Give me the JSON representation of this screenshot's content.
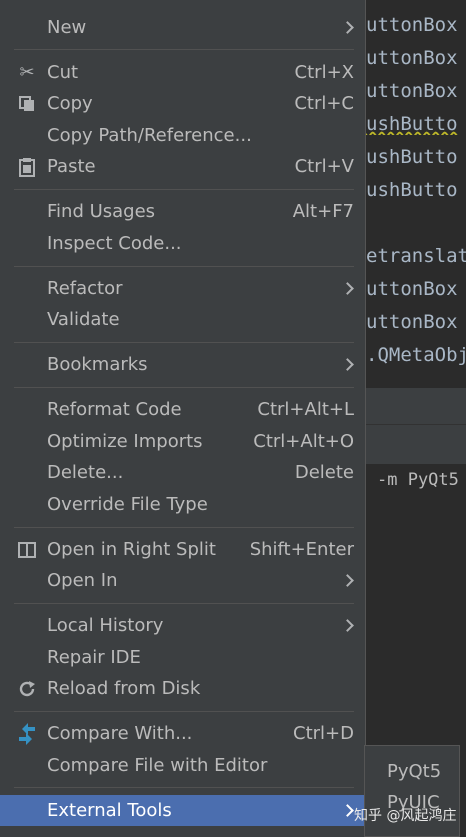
{
  "editor": {
    "code_lines": [
      "uttonBox",
      "uttonBox",
      "uttonBox",
      "ushButto",
      "ushButto",
      "ushButto",
      "",
      "etranslat",
      "uttonBox",
      "uttonBox",
      ".QMetaObj"
    ],
    "terminal_line": "-m PyQt5"
  },
  "menu": {
    "new": "New",
    "cut": "Cut",
    "cut_sc": "Ctrl+X",
    "copy": "Copy",
    "copy_sc": "Ctrl+C",
    "copy_path": "Copy Path/Reference...",
    "paste": "Paste",
    "paste_sc": "Ctrl+V",
    "find_usages": "Find Usages",
    "find_usages_sc": "Alt+F7",
    "inspect_code": "Inspect Code...",
    "refactor": "Refactor",
    "validate": "Validate",
    "bookmarks": "Bookmarks",
    "reformat_code": "Reformat Code",
    "reformat_code_sc": "Ctrl+Alt+L",
    "optimize_imports": "Optimize Imports",
    "optimize_imports_sc": "Ctrl+Alt+O",
    "delete": "Delete...",
    "delete_sc": "Delete",
    "override_file_type": "Override File Type",
    "open_right_split": "Open in Right Split",
    "open_right_split_sc": "Shift+Enter",
    "open_in": "Open In",
    "local_history": "Local History",
    "repair_ide": "Repair IDE",
    "reload_from_disk": "Reload from Disk",
    "compare_with": "Compare With...",
    "compare_with_sc": "Ctrl+D",
    "compare_file_editor": "Compare File with Editor",
    "external_tools": "External Tools"
  },
  "submenu": {
    "items": [
      "PyQt5",
      "PyUIC"
    ]
  },
  "watermark": "知乎 @风起鸿庄"
}
